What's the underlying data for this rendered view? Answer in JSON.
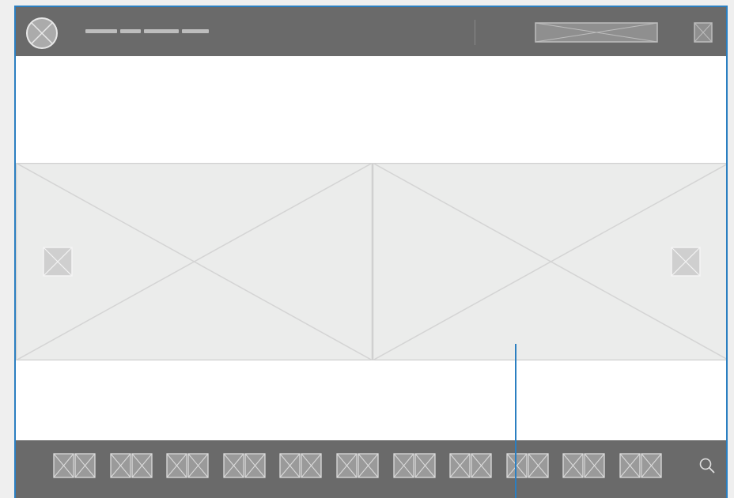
{
  "header": {
    "logo_icon": "placeholder-circle-x-icon",
    "nav_placeholder_count": 4,
    "button_icon": "image-placeholder-icon",
    "close_icon": "image-placeholder-icon"
  },
  "carousel": {
    "slides": [
      {
        "icon": "image-placeholder-icon"
      },
      {
        "icon": "image-placeholder-icon"
      }
    ],
    "prev_icon": "image-placeholder-icon",
    "next_icon": "image-placeholder-icon"
  },
  "footer": {
    "thumbnail_count": 11,
    "search_icon": "search-icon"
  },
  "colors": {
    "bar": "#6a6a6a",
    "placeholder_fill": "#ebeceb",
    "placeholder_line": "#d0d0d0",
    "accent": "#2b7fc1"
  }
}
